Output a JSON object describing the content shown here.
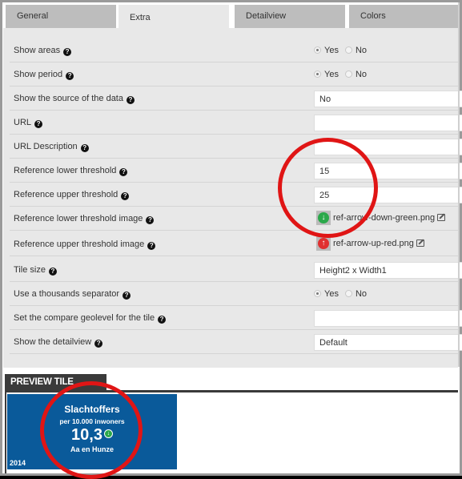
{
  "tabs": [
    {
      "label": "General",
      "active": false
    },
    {
      "label": "Extra",
      "active": true
    },
    {
      "label": "Detailview",
      "active": false
    },
    {
      "label": "Colors",
      "active": false
    }
  ],
  "form": {
    "rows": [
      {
        "label": "Show areas",
        "type": "radio",
        "options": [
          "Yes",
          "No"
        ],
        "selected": "Yes"
      },
      {
        "label": "Show period",
        "type": "radio",
        "options": [
          "Yes",
          "No"
        ],
        "selected": "Yes"
      },
      {
        "label": "Show the source of the data",
        "type": "select",
        "value": "No"
      },
      {
        "label": "URL",
        "type": "text",
        "value": ""
      },
      {
        "label": "URL Description",
        "type": "text",
        "value": ""
      },
      {
        "label": "Reference lower threshold",
        "type": "text",
        "value": "15"
      },
      {
        "label": "Reference upper threshold",
        "type": "text",
        "value": "25"
      },
      {
        "label": "Reference lower threshold image",
        "type": "image",
        "value": "ref-arrow-down-green.png",
        "icon": "arrow-down-green-icon"
      },
      {
        "label": "Reference upper threshold image",
        "type": "image",
        "value": "ref-arrow-up-red.png",
        "icon": "arrow-up-red-icon"
      },
      {
        "label": "Tile size",
        "type": "select",
        "value": "Height2 x Width1"
      },
      {
        "label": "Use a thousands separator",
        "type": "radio",
        "options": [
          "Yes",
          "No"
        ],
        "selected": "Yes"
      },
      {
        "label": "Set the compare geolevel for the tile",
        "type": "select",
        "value": ""
      },
      {
        "label": "Show the detailview",
        "type": "select",
        "value": "Default"
      }
    ],
    "help_glyph": "?"
  },
  "preview": {
    "header": "PREVIEW TILE",
    "tile": {
      "title": "Slachtoffers",
      "subtitle": "per 10.000 inwoners",
      "value": "10,3",
      "area": "Aa en Hunze",
      "year": "2014",
      "color": "#0a5a9a"
    }
  },
  "colors": {
    "accent_green": "#2aa84a",
    "accent_red": "#e03030",
    "annotation_red": "#e01515"
  }
}
